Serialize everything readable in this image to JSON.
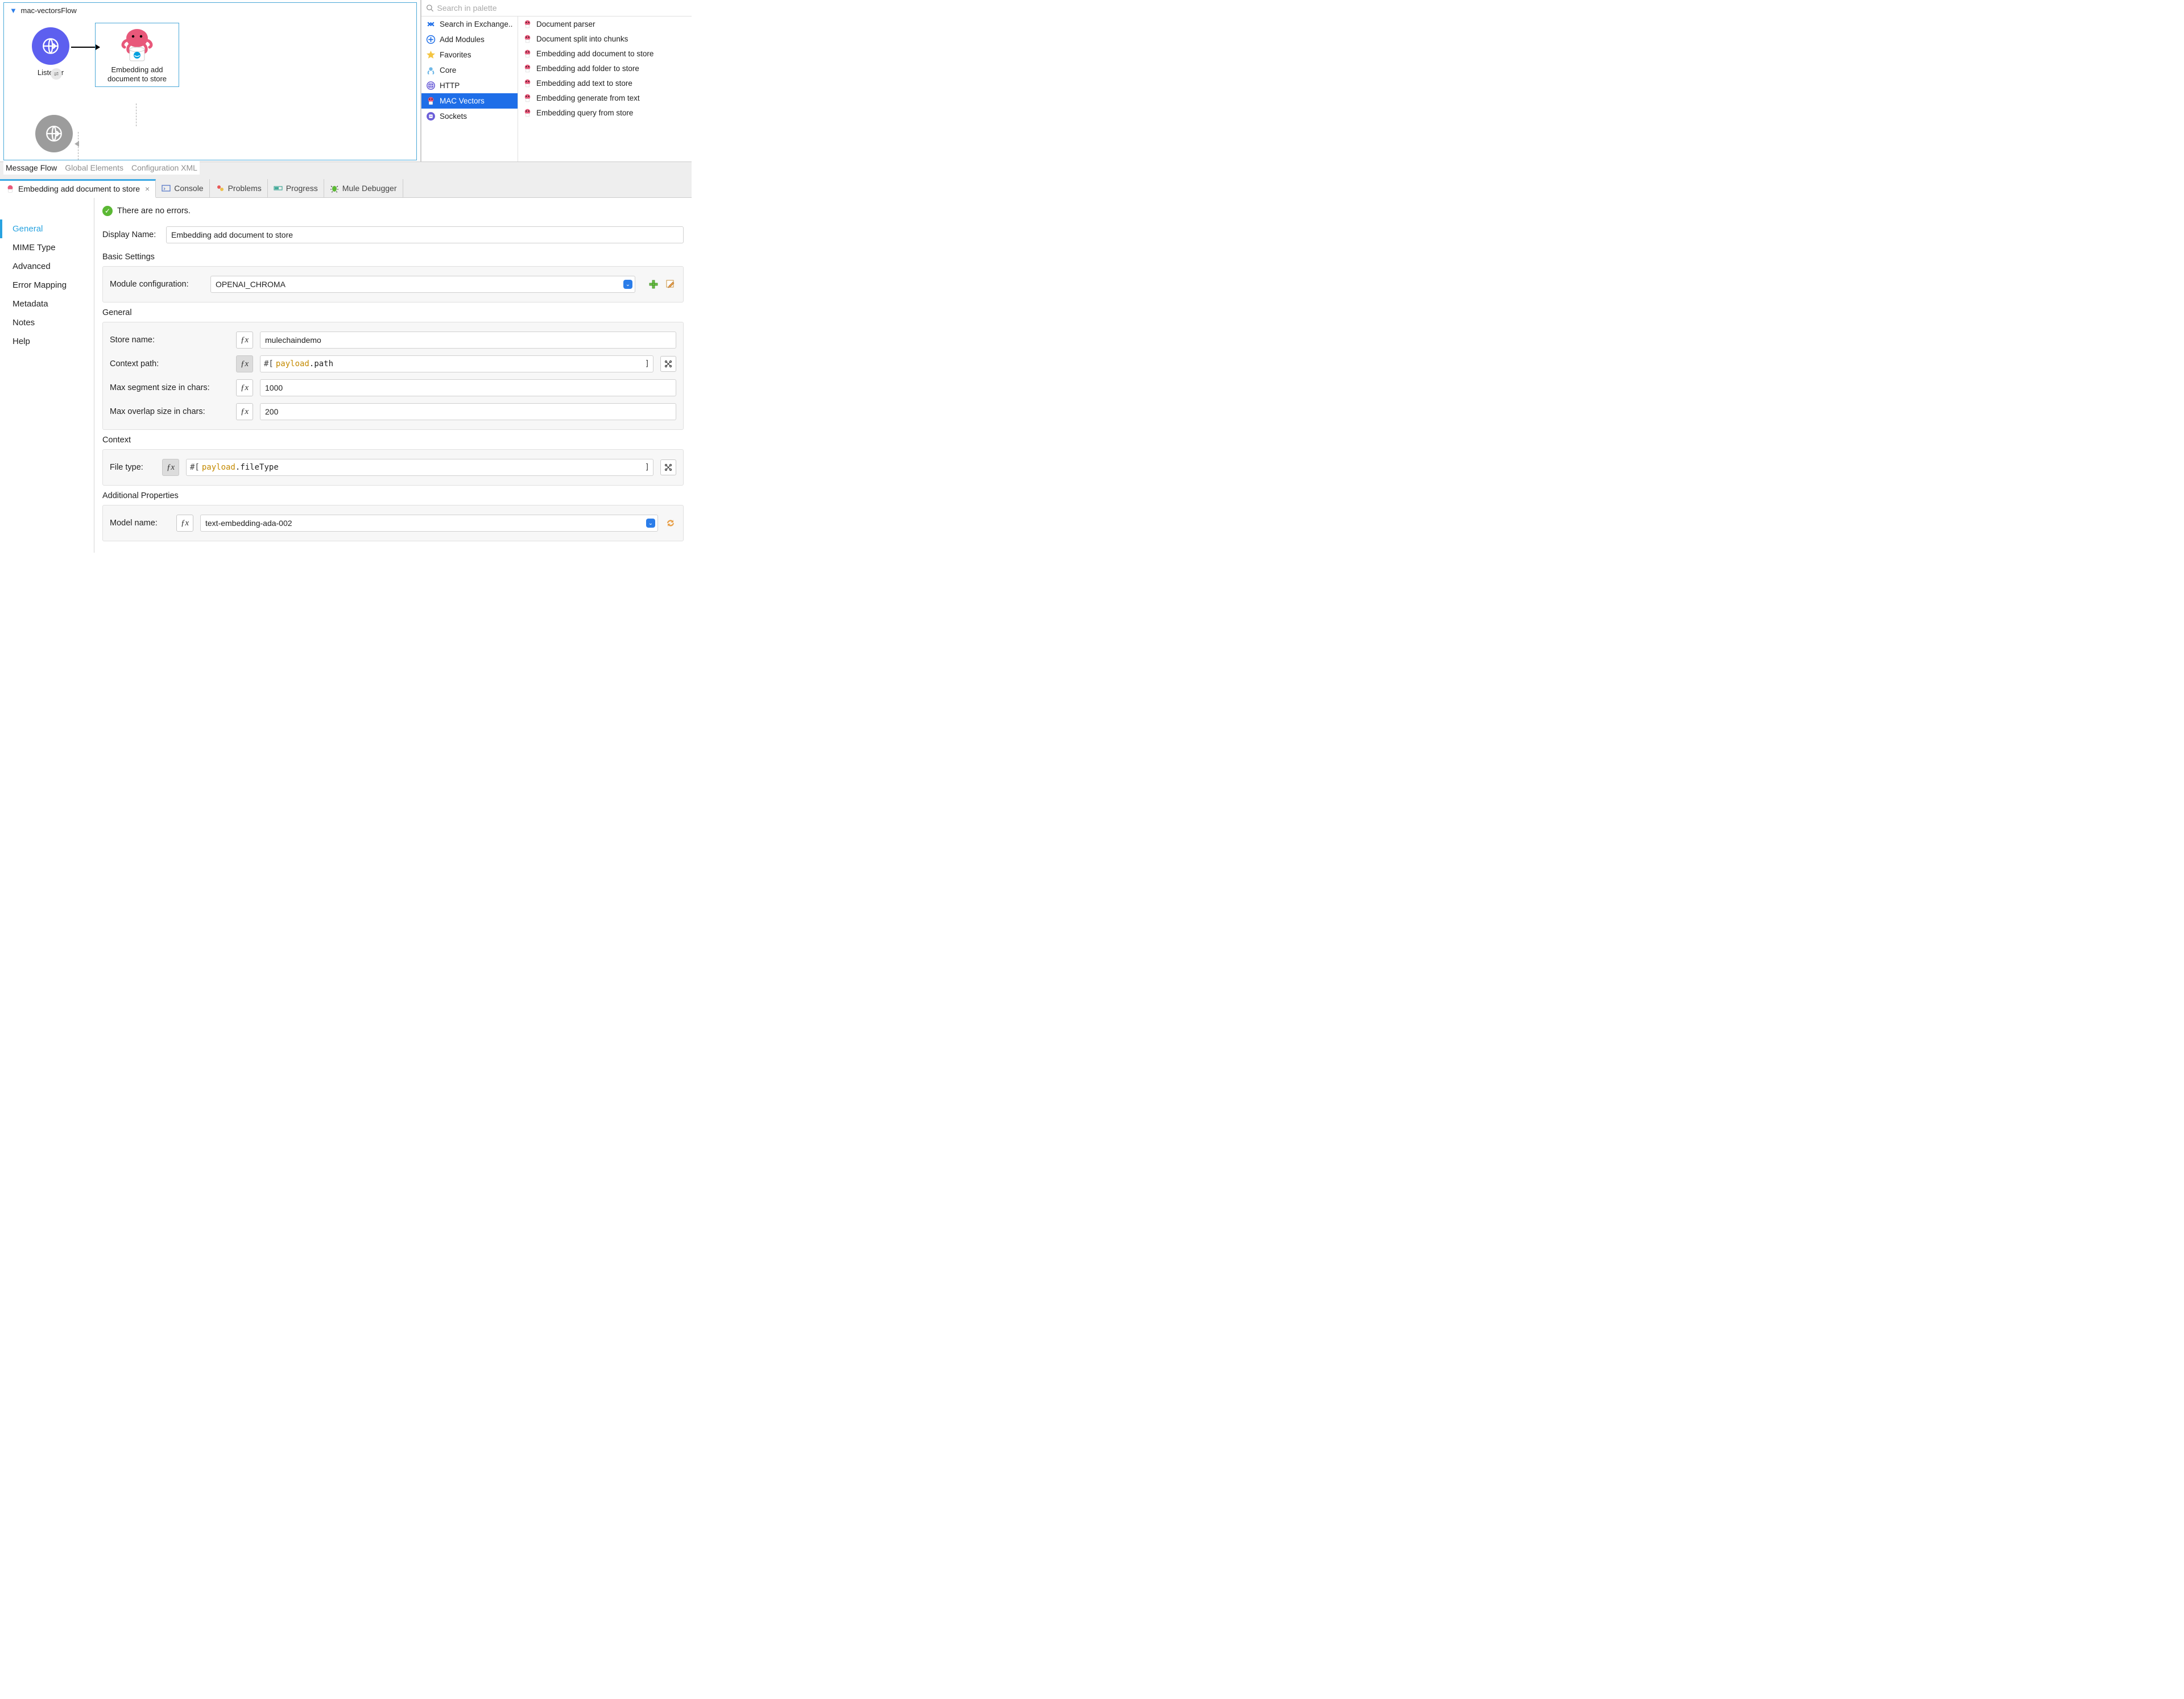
{
  "flow": {
    "name": "mac-vectorsFlow",
    "listener_label": "Listener",
    "embed_label": "Embedding add\ndocument to store"
  },
  "canvas_tabs": [
    "Message Flow",
    "Global Elements",
    "Configuration XML"
  ],
  "palette": {
    "search_placeholder": "Search in palette",
    "categories": [
      {
        "label": "Search in Exchange..",
        "icon": "exchange"
      },
      {
        "label": "Add Modules",
        "icon": "plus-circle"
      },
      {
        "label": "Favorites",
        "icon": "star"
      },
      {
        "label": "Core",
        "icon": "core"
      },
      {
        "label": "HTTP",
        "icon": "http"
      },
      {
        "label": "MAC Vectors",
        "icon": "octo",
        "selected": true
      },
      {
        "label": "Sockets",
        "icon": "socket"
      }
    ],
    "operations": [
      "Document parser",
      "Document split into chunks",
      "Embedding add document to store",
      "Embedding add folder to store",
      "Embedding add text to store",
      "Embedding generate from text",
      "Embedding query from store"
    ]
  },
  "bottom_tabs": {
    "active": "Embedding add document to store",
    "others": [
      "Console",
      "Problems",
      "Progress",
      "Mule Debugger"
    ]
  },
  "status": "There are no errors.",
  "sidebar": [
    "General",
    "MIME Type",
    "Advanced",
    "Error Mapping",
    "Metadata",
    "Notes",
    "Help"
  ],
  "form": {
    "display_name_label": "Display Name:",
    "display_name": "Embedding add document to store",
    "basic_settings_title": "Basic Settings",
    "module_config_label": "Module configuration:",
    "module_config": "OPENAI_CHROMA",
    "general_title": "General",
    "store_name_label": "Store name:",
    "store_name": "mulechaindemo",
    "context_path_label": "Context path:",
    "context_path_expr": {
      "ident": "payload",
      "prop": "path"
    },
    "max_seg_label": "Max segment size in chars:",
    "max_seg": "1000",
    "max_overlap_label": "Max overlap size in chars:",
    "max_overlap": "200",
    "context_title": "Context",
    "file_type_label": "File type:",
    "file_type_expr": {
      "ident": "payload",
      "prop": "fileType"
    },
    "addl_title": "Additional Properties",
    "model_name_label": "Model name:",
    "model_name": "text-embedding-ada-002"
  }
}
